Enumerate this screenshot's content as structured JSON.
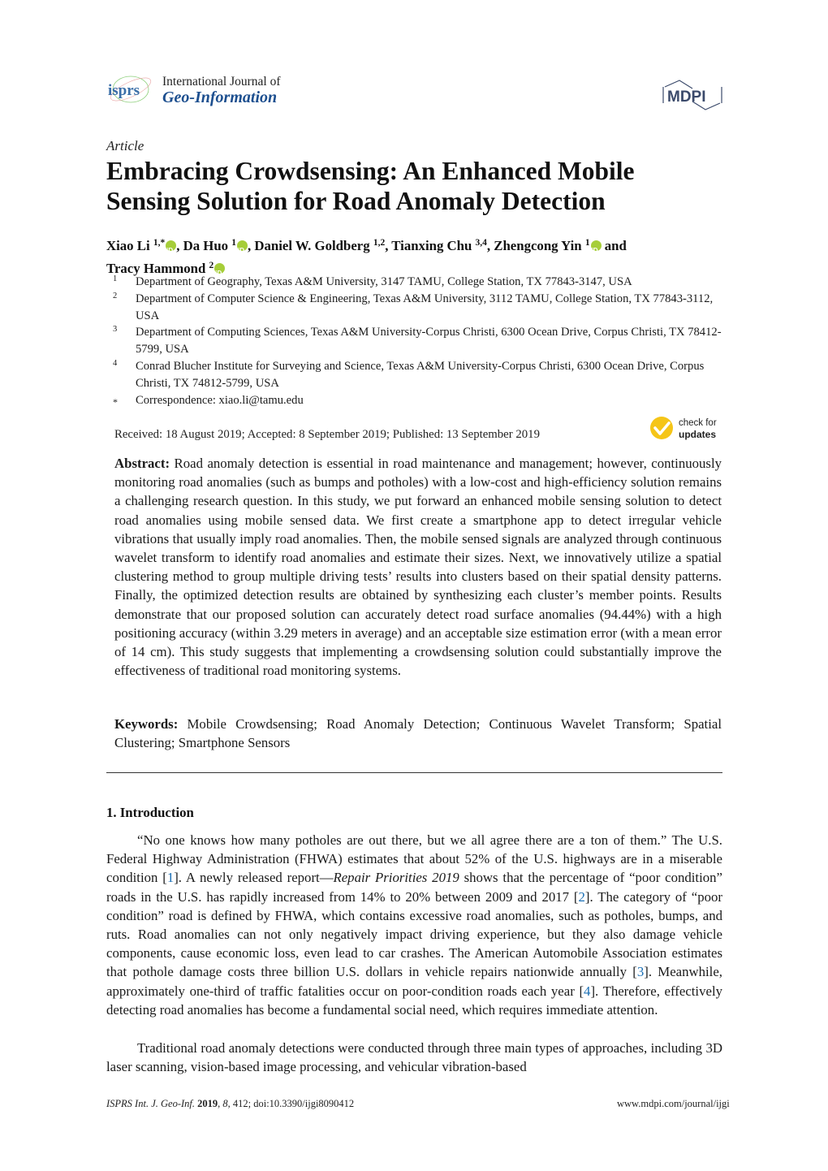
{
  "header": {
    "journal_logo_text": "isprs",
    "journal_name_line1": "International Journal of",
    "journal_name_line2": "Geo-Information",
    "publisher_logo_text": "MDPI"
  },
  "article": {
    "type": "Article",
    "title": "Embracing Crowdsensing: An Enhanced Mobile Sensing Solution for Road Anomaly Detection",
    "authors": [
      {
        "name": "Xiao Li",
        "affil": "1,*",
        "orcid": true
      },
      {
        "name": "Da Huo",
        "affil": "1",
        "orcid": true
      },
      {
        "name": "Daniel W. Goldberg",
        "affil": "1,2",
        "orcid": false
      },
      {
        "name": "Tianxing Chu",
        "affil": "3,4",
        "orcid": false
      },
      {
        "name": "Zhengcong Yin",
        "affil": "1",
        "orcid": true
      },
      {
        "name": "Tracy Hammond",
        "affil": "2",
        "orcid": true
      }
    ],
    "author_separator": ", ",
    "author_last_joiner": " and",
    "affiliations": [
      {
        "mark": "1",
        "text": "Department of Geography, Texas A&M University, 3147 TAMU, College Station, TX 77843-3147, USA"
      },
      {
        "mark": "2",
        "text": "Department of Computer Science & Engineering, Texas A&M University, 3112 TAMU, College Station, TX 77843-3112, USA"
      },
      {
        "mark": "3",
        "text": "Department of Computing Sciences, Texas A&M University-Corpus Christi, 6300 Ocean Drive, Corpus Christi, TX 78412-5799, USA"
      },
      {
        "mark": "4",
        "text": "Conrad Blucher Institute for Surveying and Science, Texas A&M University-Corpus Christi, 6300 Ocean Drive, Corpus Christi, TX 74812-5799, USA"
      },
      {
        "mark": "*",
        "text": "Correspondence: xiao.li@tamu.edu"
      }
    ],
    "dates": "Received: 18 August 2019; Accepted: 8 September 2019; Published: 13 September 2019",
    "check_updates": {
      "line1": "check for",
      "line2": "updates"
    },
    "abstract_label": "Abstract:",
    "abstract": "Road anomaly detection is essential in road maintenance and management; however, continuously monitoring road anomalies (such as bumps and potholes) with a low-cost and high-efficiency solution remains a challenging research question. In this study, we put forward an enhanced mobile sensing solution to detect road anomalies using mobile sensed data. We first create a smartphone app to detect irregular vehicle vibrations that usually imply road anomalies. Then, the mobile sensed signals are analyzed through continuous wavelet transform to identify road anomalies and estimate their sizes. Next, we innovatively utilize a spatial clustering method to group multiple driving tests’ results into clusters based on their spatial density patterns. Finally, the optimized detection results are obtained by synthesizing each cluster’s member points. Results demonstrate that our proposed solution can accurately detect road surface anomalies (94.44%) with a high positioning accuracy (within 3.29 meters in average) and an acceptable size estimation error (with a mean error of 14 cm). This study suggests that implementing a crowdsensing solution could substantially improve the effectiveness of traditional road monitoring systems.",
    "keywords_label": "Keywords:",
    "keywords": "Mobile Crowdsensing; Road Anomaly Detection; Continuous Wavelet Transform; Spatial Clustering; Smartphone Sensors"
  },
  "introduction": {
    "heading": "1. Introduction",
    "p1": [
      {
        "t": "“No one knows how many potholes are out there, but we all agree there are a ton of them.” The U.S. Federal Highway Administration (FHWA) estimates that about 52% of the U.S. highways are in a miserable condition ["
      },
      {
        "t": "1",
        "cite": true
      },
      {
        "t": "]. A newly released report—"
      },
      {
        "t": "Repair Priorities 2019",
        "italic": true
      },
      {
        "t": " shows that the percentage of “poor condition” roads in the U.S. has rapidly increased from 14% to 20% between 2009 and 2017 ["
      },
      {
        "t": "2",
        "cite": true
      },
      {
        "t": "]. The category of “poor condition” road is defined by FHWA, which contains excessive road anomalies, such as potholes, bumps, and ruts. Road anomalies can not only negatively impact driving experience, but they also damage vehicle components, cause economic loss, even lead to car crashes. The American Automobile Association estimates that pothole damage costs three billion U.S. dollars in vehicle repairs nationwide annually ["
      },
      {
        "t": "3",
        "cite": true
      },
      {
        "t": "]. Meanwhile, approximately one-third of traffic fatalities occur on poor-condition roads each year ["
      },
      {
        "t": "4",
        "cite": true
      },
      {
        "t": "]. Therefore, effectively detecting road anomalies has become a fundamental social need, which requires immediate attention."
      }
    ],
    "p2": "Traditional road anomaly detections were conducted through three main types of approaches, including 3D laser scanning, vision-based image processing, and vehicular vibration-based"
  },
  "footer": {
    "journal_abbrev": "ISPRS Int. J. Geo-Inf.",
    "year": "2019",
    "volume": "8",
    "rest": ", 412; doi:10.3390/ijgi8090412",
    "url": "www.mdpi.com/journal/ijgi"
  },
  "colors": {
    "journal_blue": "#1d4f8f",
    "citation_blue": "#1a6fb5",
    "orcid_green": "#a6ce39",
    "check_updates_yellow": "#f5c518"
  }
}
